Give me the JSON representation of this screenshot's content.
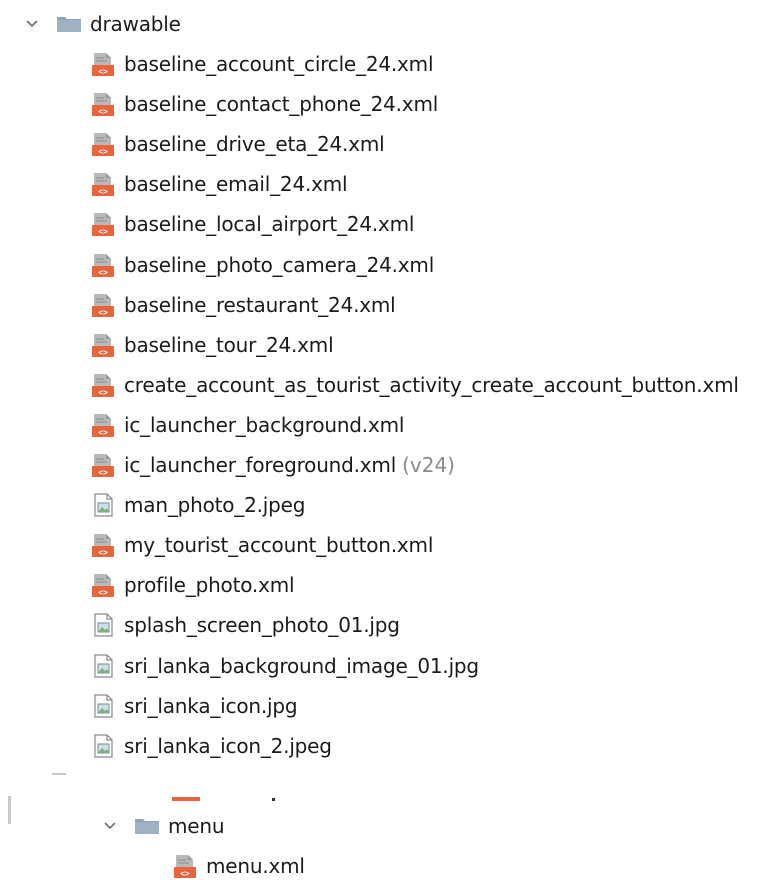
{
  "tree": {
    "drawable": {
      "label": "drawable",
      "icon": "folder-icon",
      "expanded": true,
      "files": [
        {
          "name": "baseline_account_circle_24.xml",
          "type": "xml"
        },
        {
          "name": "baseline_contact_phone_24.xml",
          "type": "xml"
        },
        {
          "name": "baseline_drive_eta_24.xml",
          "type": "xml"
        },
        {
          "name": "baseline_email_24.xml",
          "type": "xml"
        },
        {
          "name": "baseline_local_airport_24.xml",
          "type": "xml"
        },
        {
          "name": "baseline_photo_camera_24.xml",
          "type": "xml"
        },
        {
          "name": "baseline_restaurant_24.xml",
          "type": "xml"
        },
        {
          "name": "baseline_tour_24.xml",
          "type": "xml"
        },
        {
          "name": "create_account_as_tourist_activity_create_account_button.xml",
          "type": "xml"
        },
        {
          "name": "ic_launcher_background.xml",
          "type": "xml"
        },
        {
          "name": "ic_launcher_foreground.xml",
          "type": "xml",
          "suffix": "(v24)"
        },
        {
          "name": "man_photo_2.jpeg",
          "type": "image"
        },
        {
          "name": "my_tourist_account_button.xml",
          "type": "xml"
        },
        {
          "name": "profile_photo.xml",
          "type": "xml"
        },
        {
          "name": "splash_screen_photo_01.jpg",
          "type": "image"
        },
        {
          "name": "sri_lanka_background_image_01.jpg",
          "type": "image"
        },
        {
          "name": "sri_lanka_icon.jpg",
          "type": "image"
        },
        {
          "name": "sri_lanka_icon_2.jpeg",
          "type": "image"
        }
      ]
    },
    "menu": {
      "label": "menu",
      "icon": "folder-icon",
      "expanded": true,
      "files": [
        {
          "name": "menu.xml",
          "type": "xml"
        }
      ]
    }
  },
  "colors": {
    "folder": "#8fa3b7",
    "xml_orange": "#e8643c",
    "image_green": "#7fb07a"
  }
}
